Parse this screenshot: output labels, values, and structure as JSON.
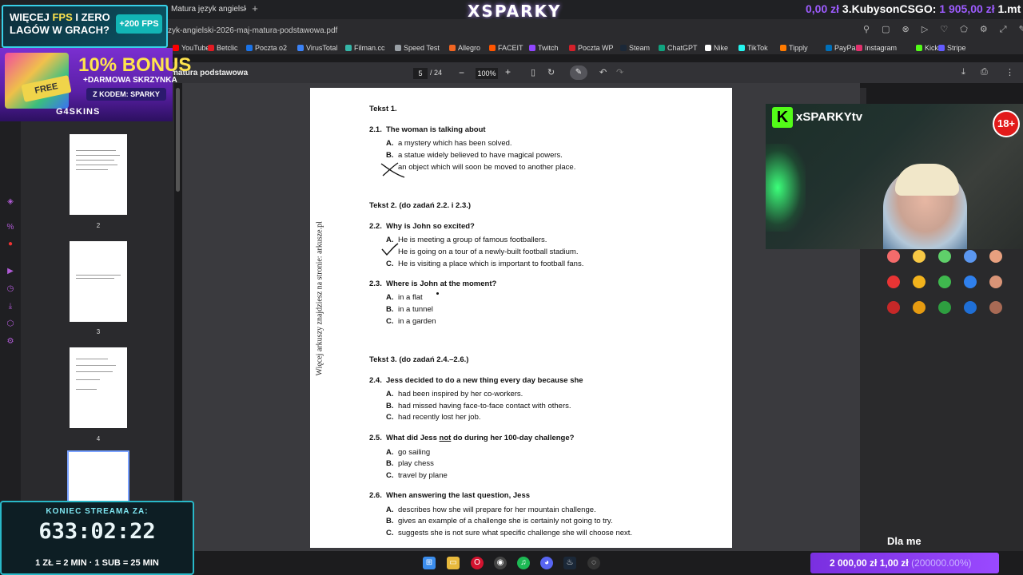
{
  "browser": {
    "active_tab": "Matura język angielski",
    "url": "zyk-angielski-2026-maj-matura-podstawowa.pdf",
    "channel_logo": "XSPARKY",
    "goal_ticker_prefix": "0,00 zł",
    "goal_ticker_name": "3.KubysonCSGO:",
    "goal_ticker_amount": "1 905,00 zł",
    "goal_ticker_suffix": "1.mt",
    "bookmarks": [
      "YouTube",
      "Betclic",
      "Poczta o2",
      "VirusTotal",
      "Filman.cc",
      "Speed Test",
      "Allegro",
      "FACEIT",
      "Twitch",
      "Poczta WP",
      "Steam",
      "ChatGPT",
      "Nike",
      "TikTok",
      "Tipply",
      "PayPal",
      "Instagram",
      "Kick",
      "Stripe"
    ],
    "bookmark_colors": [
      "#ff0000",
      "#e31b23",
      "#1a73e8",
      "#3b82f6",
      "#35b6a8",
      "#9aa0a6",
      "#f16522",
      "#ff5500",
      "#9146ff",
      "#d4202a",
      "#1b2838",
      "#10a37f",
      "#ffffff",
      "#25f4ee",
      "#ff7a00",
      "#0070ba",
      "#e1306c",
      "#53fc18",
      "#635bff"
    ]
  },
  "pdf_toolbar": {
    "title": "matura podstawowa",
    "page_current": "5",
    "page_total": "/ 24",
    "zoom": "100%"
  },
  "thumbnails": [
    {
      "num": "2"
    },
    {
      "num": "3"
    },
    {
      "num": "4"
    }
  ],
  "pdf": {
    "watermark": "Więcej arkuszy znajdziesz na stronie: arkusze.pl",
    "text1_header": "Tekst 1.",
    "q21_num": "2.1.",
    "q21": "The woman is talking about",
    "q21_a": "a mystery which has been solved.",
    "q21_b": "a statue widely believed to have magical powers.",
    "q21_c": "an object which will soon be moved to another place.",
    "text2_header": "Tekst 2. (do zadań 2.2. i 2.3.)",
    "q22_num": "2.2.",
    "q22": "Why is John so excited?",
    "q22_a": "He is meeting a group of famous footballers.",
    "q22_b": "He is going on a tour of a newly-built football stadium.",
    "q22_c": "He is visiting a place which is important to football fans.",
    "q23_num": "2.3.",
    "q23": "Where is John at the moment?",
    "q23_a": "in a flat",
    "q23_b": "in a tunnel",
    "q23_c": "in a garden",
    "text3_header": "Tekst 3. (do zadań 2.4.–2.6.)",
    "q24_num": "2.4.",
    "q24": "Jess decided to do a new thing every day because she",
    "q24_a": "had been inspired by her co-workers.",
    "q24_b": "had missed having face-to-face contact with others.",
    "q24_c": "had recently lost her job.",
    "q25_num": "2.5.",
    "q25_pre": "What did Jess",
    "q25_not": "not",
    "q25_post": "do during her 100-day challenge?",
    "q25_a": "go sailing",
    "q25_b": "play chess",
    "q25_c": "travel by plane",
    "q26_num": "2.6.",
    "q26": "When answering the last question, Jess",
    "q26_a": "describes how she will prepare for her mountain challenge.",
    "q26_b": "gives an example of a challenge she is certainly not going to try.",
    "q26_c": "suggests she is not sure what specific challenge she will choose next.",
    "label_a": "A.",
    "label_b": "B.",
    "label_c": "C."
  },
  "overlays": {
    "fps_promo_line1": "WIĘCEJ",
    "fps_promo_fps": "FPS",
    "fps_promo_line1b": "I ZERO",
    "fps_promo_line2": "LAGÓW W GRACH?",
    "fps_pill": "+200 FPS",
    "bonus_big": "10% BONUS",
    "bonus_sub": "+DARMOWA SKRZYNKA",
    "bonus_code": "Z KODEM: SPARKY",
    "free_tag": "FREE",
    "brand": "G4SKINS",
    "cam_handle": "xSPARKYtv",
    "cam_logo": "K",
    "age_badge": "18+",
    "dla_me": "Dla me",
    "timer_title": "KONIEC STREAMA ZA:",
    "timer_value": "633:02:22",
    "timer_rates": "1 ZŁ = 2 MIN · 1 SUB = 25 MIN",
    "donation_amount": "2 000,00 zł",
    "donation_current": "1,00 zł",
    "donation_goal": "(200000.00%)"
  },
  "palette_colors": [
    [
      "#f46b6b",
      "#f7c845",
      "#5fcf6a",
      "#5b97f0",
      "#e8a07f"
    ],
    [
      "#e83434",
      "#f2b31c",
      "#3fb84e",
      "#2f80ed",
      "#d99477"
    ],
    [
      "#c62828",
      "#e69b11",
      "#2e9e40",
      "#1f6fd6",
      "#a86a55"
    ]
  ]
}
